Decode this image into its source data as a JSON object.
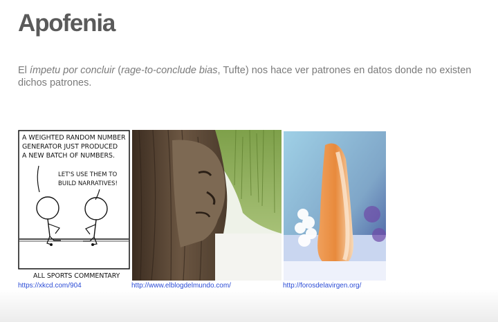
{
  "slide": {
    "title": "Apofenia",
    "body": {
      "part1": "El ",
      "em1": "ímpetu por concluir",
      "part2": " (",
      "em2": "rage-to-conclude bias",
      "part3": ", Tufte) nos hace ver patrones en datos donde no existen dichos patrones."
    }
  },
  "images": [
    {
      "name": "xkcd-comic",
      "caption": "https://xkcd.com/904",
      "comic": {
        "narration_lines": [
          "A WEIGHTED RANDOM NUMBER",
          "GENERATOR JUST PRODUCED",
          "A NEW BATCH OF NUMBERS."
        ],
        "speech_lines": [
          "LET'S USE THEM TO",
          "BUILD NARRATIVES!"
        ],
        "footer": "ALL SPORTS COMMENTARY"
      }
    },
    {
      "name": "tree-face-photo",
      "caption": "http://www.elblogdelmundo.com/"
    },
    {
      "name": "virgin-figure-photo",
      "caption": "http://forosdelavirgen.org/"
    }
  ],
  "colors": {
    "title": "#5a5a5a",
    "body": "#7a7a7a",
    "link": "#2a4bd6"
  }
}
